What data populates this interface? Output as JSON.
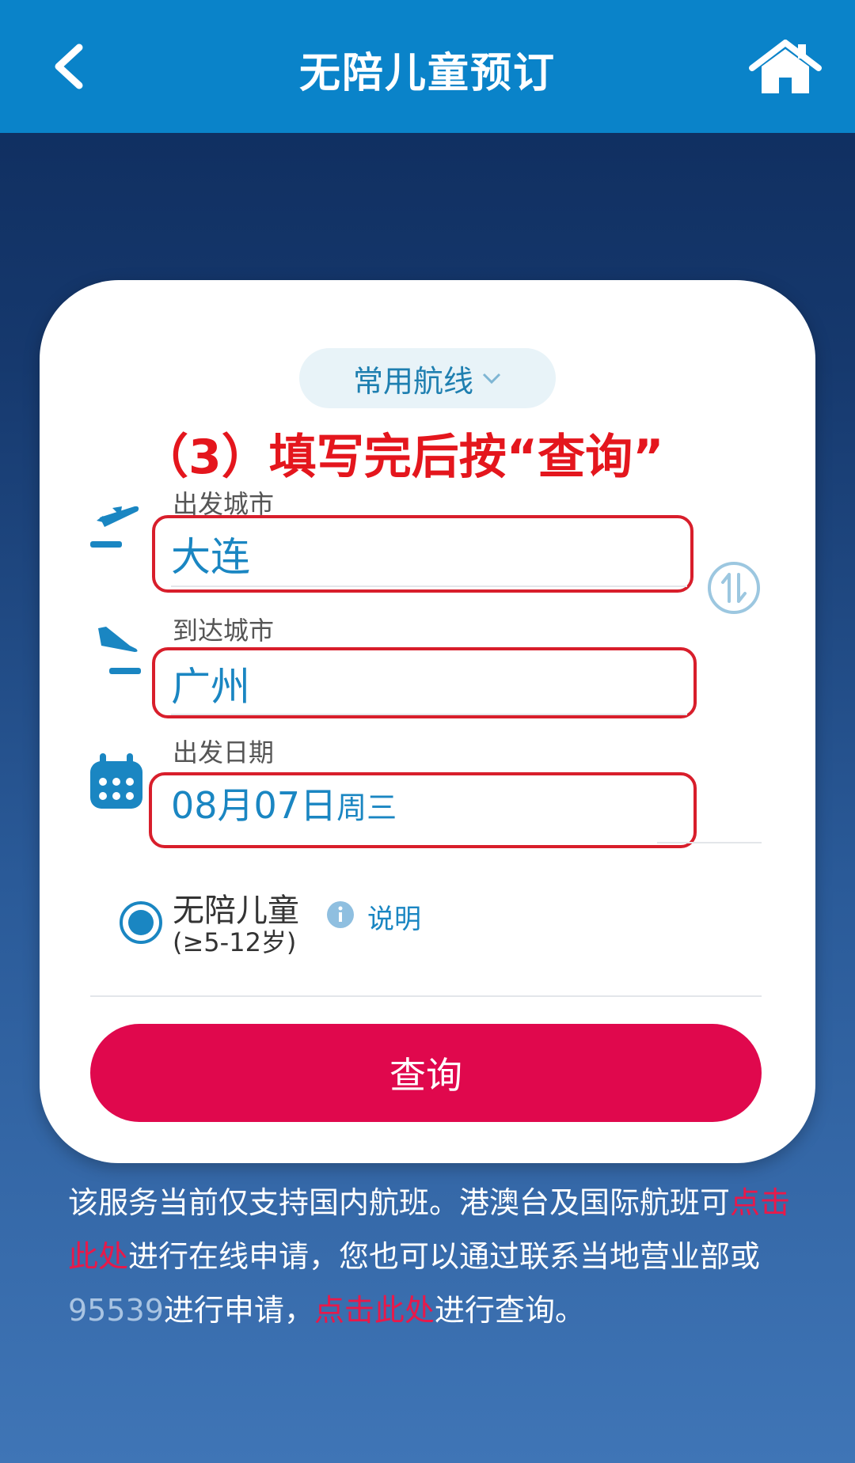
{
  "header": {
    "title": "无陪儿童预订",
    "back_icon": "chevron-left-icon",
    "home_icon": "home-icon",
    "bg_color": "#0a83c9"
  },
  "form": {
    "route_pill_label": "常用航线",
    "annotation": "（3）填写完后按“查询”",
    "departure": {
      "label": "出发城市",
      "value": "大连",
      "icon": "plane-takeoff-icon"
    },
    "arrival": {
      "label": "到达城市",
      "value": "广州",
      "icon": "plane-landing-icon"
    },
    "date": {
      "label": "出发日期",
      "value": "08月07日",
      "weekday": "周三",
      "icon": "calendar-icon"
    },
    "swap_icon": "swap-icon",
    "passenger_type": {
      "label": "无陪儿童",
      "age_range": "(≥5-12岁)",
      "selected": true
    },
    "explain_label": "说明",
    "search_label": "查询",
    "accent_color": "#1a86c2",
    "button_color": "#e0084d",
    "annotation_color": "#e4161d"
  },
  "notice": {
    "part1": "该服务当前仅支持国内航班。港澳台及国际航班可",
    "link1": "点击此处",
    "part2": "进行在线申请，您也可以通过联系当地营业部或",
    "phone": "95539",
    "part3": "进行申请，",
    "link2": "点击此处",
    "part4": "进行查询。"
  }
}
